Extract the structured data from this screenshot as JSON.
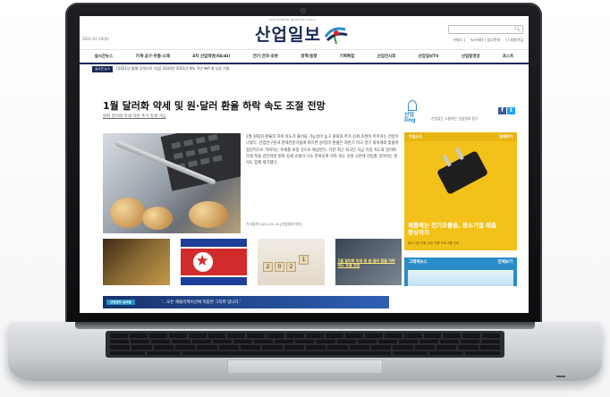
{
  "site": {
    "date": "2021-01-19(화)",
    "logo_small": "THE KOREAN INDUSTRY DAILY",
    "logo": "산업일보",
    "search_placeholder": "",
    "toplinks": [
      "키워드 |",
      "뉴스레터 | 광고문의",
      "|  I 회원가입"
    ]
  },
  "nav": {
    "items": [
      "실시간뉴스",
      "기계·공구·부품·소재",
      "4차 산업혁명(FA/AI)",
      "전기·전자·로봇",
      "정책/동향",
      "기획특집",
      "산업전시회",
      "산업일보TV",
      "산업동영상",
      "포스트"
    ]
  },
  "ticker": {
    "badge": "실시간 뉴스",
    "text": "[2021년 올해 무엇으로 사업] 2020년 2021년 8% 작년 빠르게 상승 기용"
  },
  "main": {
    "headline": "1월 달러화 약세 및 원·달러 환율 하락 속도 조절 전망",
    "subline": "원화 달러화 약세 하반 추가 강세 가능",
    "article": "1월 원화의 환율의 하락 속도가 줄어들 가능성이 높고 원화의 추가 강세 조절이 이어지는 전망이 나왔다. 산업연구원과 경제전문가들에 따르면 원/달러 환율은 하반기 미국 경기 회복세와 맞물려 점진적으로 하락하는 추세를 보일 것으로 예상된다. 다만 최근 외국인 자금 유입 속도와 달러화 약세 폭을 감안하면 원화 강세 흐름이 다소 완화되며 하락 속도 조절 국면에 진입할 것이라는 분석도 함께 제기됐다.",
    "byline": "기사입력 2021.01.19 [산업일보기자]",
    "thumb4_caption": "1월 달러화 약세 및 원·달러 환율 하락 속도 조절 전망"
  },
  "banner": {
    "tag": "산업일보 글로벌",
    "text": "'...모든 애플리케이션에 적합한 그리퍼 입니다.'"
  },
  "sidebar": {
    "logo": "산업\nling",
    "tagline": "산업있는 소통하는 산업정보 창구",
    "social": [
      "f",
      "t"
    ],
    "ad_label": "기업소식",
    "ad_more": "전체보기",
    "ad_text": "제품에는 전기모듈을, 중소기업 매출 향상까지",
    "ad_small": "중소기업 전용 사업 지원 프로그램 안내",
    "graphic_label": "그래픽뉴스",
    "graphic_more": "전체보기"
  },
  "colors": {
    "brand_navy": "#1a2a55",
    "accent_blue": "#2a8cc8",
    "ad_yellow": "#f2c21a"
  }
}
